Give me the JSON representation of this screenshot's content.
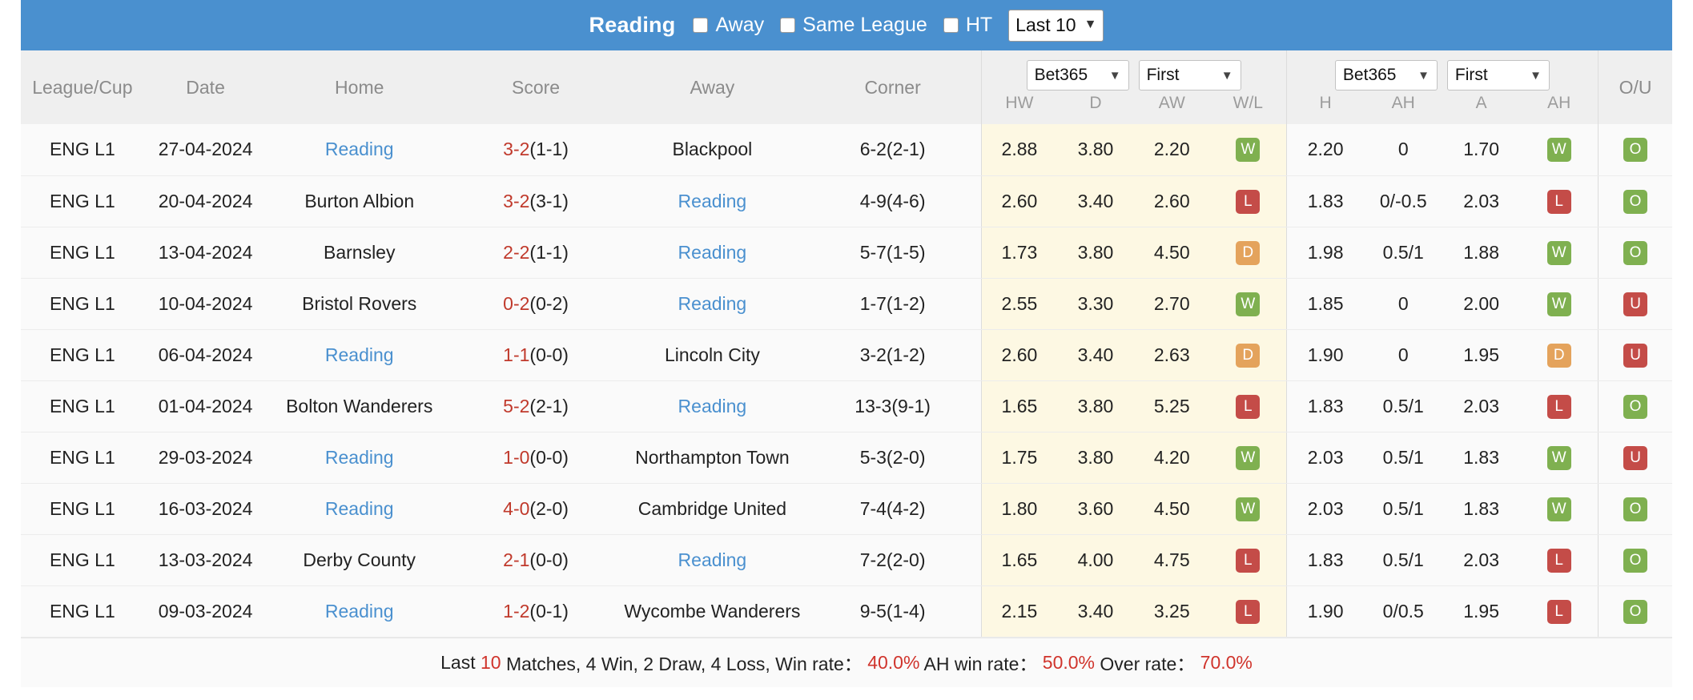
{
  "header": {
    "team": "Reading",
    "filters": [
      {
        "label": "Away",
        "checked": false
      },
      {
        "label": "Same League",
        "checked": false
      },
      {
        "label": "HT",
        "checked": false
      }
    ],
    "range_select": {
      "value": "Last 10",
      "caret": "chevron-down-icon"
    }
  },
  "columns": {
    "league": "League/Cup",
    "date": "Date",
    "home": "Home",
    "score": "Score",
    "away": "Away",
    "corner": "Corner",
    "ou": "O/U"
  },
  "odds_group_1": {
    "bookmaker": "Bet365",
    "phase": "First",
    "sub": [
      "HW",
      "D",
      "AW",
      "W/L"
    ]
  },
  "odds_group_2": {
    "bookmaker": "Bet365",
    "phase": "First",
    "sub": [
      "H",
      "AH",
      "A",
      "AH"
    ]
  },
  "rows": [
    {
      "league": "ENG L1",
      "date": "27-04-2024",
      "home": "Reading",
      "home_is_team": true,
      "score_main": "3-2",
      "score_half": "(1-1)",
      "away": "Blackpool",
      "away_is_team": false,
      "corner": "6-2(2-1)",
      "hw": "2.88",
      "d": "3.80",
      "aw": "2.20",
      "wl": "W",
      "h": "2.20",
      "ah1": "0",
      "a": "1.70",
      "ah2": "W",
      "ou": "O"
    },
    {
      "league": "ENG L1",
      "date": "20-04-2024",
      "home": "Burton Albion",
      "home_is_team": false,
      "score_main": "3-2",
      "score_half": "(3-1)",
      "away": "Reading",
      "away_is_team": true,
      "corner": "4-9(4-6)",
      "hw": "2.60",
      "d": "3.40",
      "aw": "2.60",
      "wl": "L",
      "h": "1.83",
      "ah1": "0/-0.5",
      "a": "2.03",
      "ah2": "L",
      "ou": "O"
    },
    {
      "league": "ENG L1",
      "date": "13-04-2024",
      "home": "Barnsley",
      "home_is_team": false,
      "score_main": "2-2",
      "score_half": "(1-1)",
      "away": "Reading",
      "away_is_team": true,
      "corner": "5-7(1-5)",
      "hw": "1.73",
      "d": "3.80",
      "aw": "4.50",
      "wl": "D",
      "h": "1.98",
      "ah1": "0.5/1",
      "a": "1.88",
      "ah2": "W",
      "ou": "O"
    },
    {
      "league": "ENG L1",
      "date": "10-04-2024",
      "home": "Bristol Rovers",
      "home_is_team": false,
      "score_main": "0-2",
      "score_half": "(0-2)",
      "away": "Reading",
      "away_is_team": true,
      "corner": "1-7(1-2)",
      "hw": "2.55",
      "d": "3.30",
      "aw": "2.70",
      "wl": "W",
      "h": "1.85",
      "ah1": "0",
      "a": "2.00",
      "ah2": "W",
      "ou": "U"
    },
    {
      "league": "ENG L1",
      "date": "06-04-2024",
      "home": "Reading",
      "home_is_team": true,
      "score_main": "1-1",
      "score_half": "(0-0)",
      "away": "Lincoln City",
      "away_is_team": false,
      "corner": "3-2(1-2)",
      "hw": "2.60",
      "d": "3.40",
      "aw": "2.63",
      "wl": "D",
      "h": "1.90",
      "ah1": "0",
      "a": "1.95",
      "ah2": "D",
      "ou": "U"
    },
    {
      "league": "ENG L1",
      "date": "01-04-2024",
      "home": "Bolton Wanderers",
      "home_is_team": false,
      "score_main": "5-2",
      "score_half": "(2-1)",
      "away": "Reading",
      "away_is_team": true,
      "corner": "13-3(9-1)",
      "hw": "1.65",
      "d": "3.80",
      "aw": "5.25",
      "wl": "L",
      "h": "1.83",
      "ah1": "0.5/1",
      "a": "2.03",
      "ah2": "L",
      "ou": "O"
    },
    {
      "league": "ENG L1",
      "date": "29-03-2024",
      "home": "Reading",
      "home_is_team": true,
      "score_main": "1-0",
      "score_half": "(0-0)",
      "away": "Northampton Town",
      "away_is_team": false,
      "corner": "5-3(2-0)",
      "hw": "1.75",
      "d": "3.80",
      "aw": "4.20",
      "wl": "W",
      "h": "2.03",
      "ah1": "0.5/1",
      "a": "1.83",
      "ah2": "W",
      "ou": "U"
    },
    {
      "league": "ENG L1",
      "date": "16-03-2024",
      "home": "Reading",
      "home_is_team": true,
      "score_main": "4-0",
      "score_half": "(2-0)",
      "away": "Cambridge United",
      "away_is_team": false,
      "corner": "7-4(4-2)",
      "hw": "1.80",
      "d": "3.60",
      "aw": "4.50",
      "wl": "W",
      "h": "2.03",
      "ah1": "0.5/1",
      "a": "1.83",
      "ah2": "W",
      "ou": "O"
    },
    {
      "league": "ENG L1",
      "date": "13-03-2024",
      "home": "Derby County",
      "home_is_team": false,
      "score_main": "2-1",
      "score_half": "(0-0)",
      "away": "Reading",
      "away_is_team": true,
      "corner": "7-2(2-0)",
      "hw": "1.65",
      "d": "4.00",
      "aw": "4.75",
      "wl": "L",
      "h": "1.83",
      "ah1": "0.5/1",
      "a": "2.03",
      "ah2": "L",
      "ou": "O"
    },
    {
      "league": "ENG L1",
      "date": "09-03-2024",
      "home": "Reading",
      "home_is_team": true,
      "score_main": "1-2",
      "score_half": "(0-1)",
      "away": "Wycombe Wanderers",
      "away_is_team": false,
      "corner": "9-5(1-4)",
      "hw": "2.15",
      "d": "3.40",
      "aw": "3.25",
      "wl": "L",
      "h": "1.90",
      "ah1": "0/0.5",
      "a": "1.95",
      "ah2": "L",
      "ou": "O"
    }
  ],
  "footer": {
    "t1": "Last ",
    "matches_count": "10",
    "t2": " Matches, 4 Win, 2 Draw, 4 Loss, Win rate： ",
    "win_rate": "40.0%",
    "t3": " AH win rate： ",
    "ah_win_rate": "50.0%",
    "t4": " Over rate： ",
    "over_rate": "70.0%"
  },
  "colors": {
    "accent": "#4a90cf",
    "win": "#7fb050",
    "loss": "#c44c48",
    "draw": "#e4a35c",
    "score": "#c0392b",
    "odds_bg": "#fdf8e3"
  }
}
